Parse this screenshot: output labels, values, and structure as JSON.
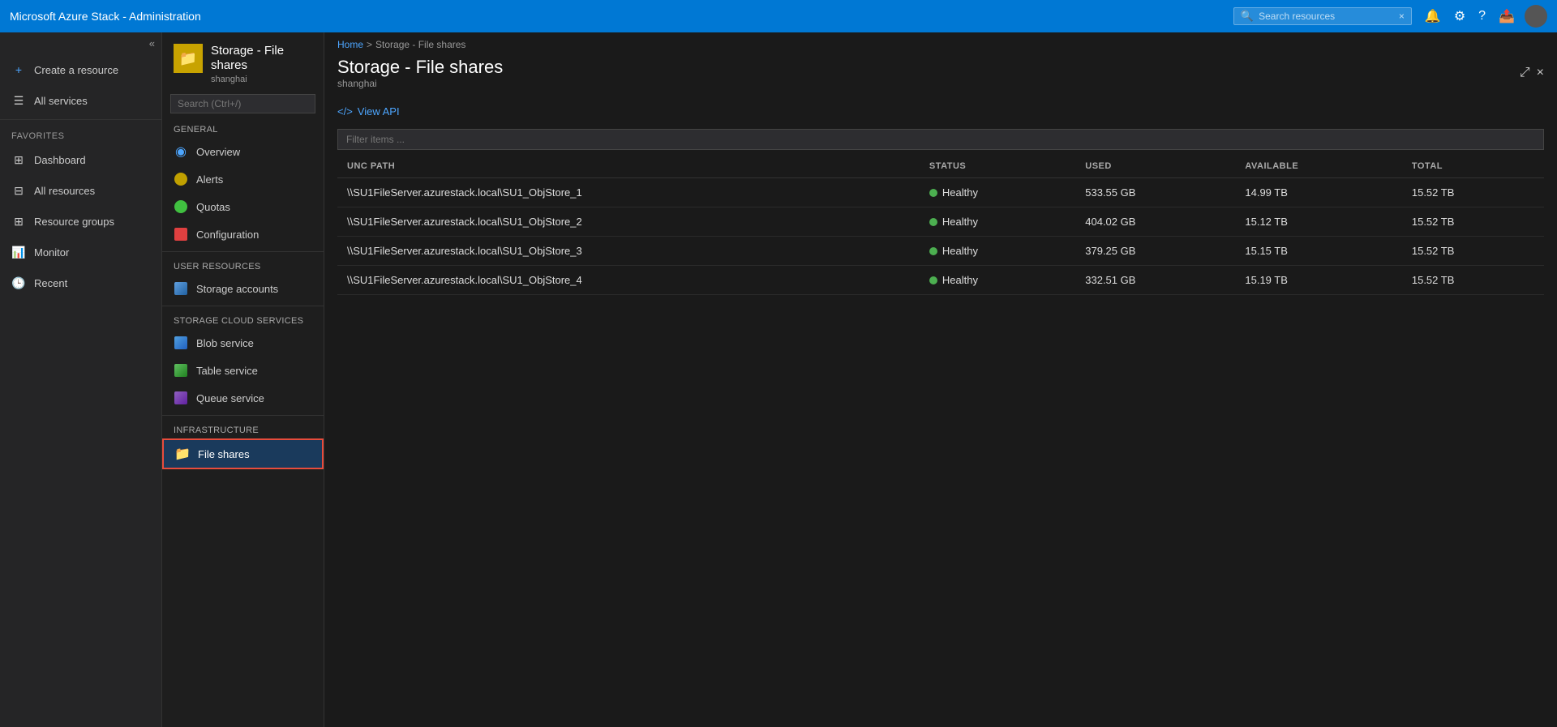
{
  "app": {
    "title": "Microsoft Azure Stack - Administration",
    "search_placeholder": "Search resources",
    "close_search": "×"
  },
  "topbar": {
    "avatar_initials": ""
  },
  "sidebar": {
    "collapse_icon": "«",
    "create_label": "Create a resource",
    "all_services_label": "All services",
    "favorites_section": "FAVORITES",
    "items": [
      {
        "label": "Dashboard",
        "icon": "⊞"
      },
      {
        "label": "All resources",
        "icon": "⊟"
      },
      {
        "label": "Resource groups",
        "icon": "⊞"
      },
      {
        "label": "Monitor",
        "icon": "📊"
      },
      {
        "label": "Recent",
        "icon": "🕒"
      }
    ]
  },
  "resource_panel": {
    "title": "Storage - File shares",
    "subtitle": "shanghai",
    "search_placeholder": "Search (Ctrl+/)",
    "general_section": "GENERAL",
    "user_resources_section": "USER RESOURCES",
    "storage_cloud_section": "STORAGE CLOUD SERVICES",
    "infrastructure_section": "INFRASTRUCTURE",
    "general_items": [
      {
        "label": "Overview",
        "icon": "overview"
      },
      {
        "label": "Alerts",
        "icon": "alerts"
      },
      {
        "label": "Quotas",
        "icon": "quotas"
      },
      {
        "label": "Configuration",
        "icon": "config"
      }
    ],
    "user_items": [
      {
        "label": "Storage accounts",
        "icon": "storage"
      }
    ],
    "cloud_items": [
      {
        "label": "Blob service",
        "icon": "blob"
      },
      {
        "label": "Table service",
        "icon": "table"
      },
      {
        "label": "Queue service",
        "icon": "queue"
      }
    ],
    "infra_items": [
      {
        "label": "File shares",
        "icon": "folder",
        "active": true
      }
    ]
  },
  "content": {
    "breadcrumb_home": "Home",
    "breadcrumb_sep": ">",
    "breadcrumb_current": "Storage - File shares",
    "title": "Storage - File shares",
    "subtitle": "shanghai",
    "window_expand": "⤢",
    "window_close": "×",
    "toolbar": {
      "view_api_label": "View API",
      "view_api_icon": "<>"
    },
    "filter_placeholder": "Filter items ...",
    "table": {
      "columns": [
        "UNC PATH",
        "STATUS",
        "USED",
        "AVAILABLE",
        "TOTAL"
      ],
      "rows": [
        {
          "unc_path": "\\\\SU1FileServer.azurestack.local\\SU1_ObjStore_1",
          "status": "Healthy",
          "used": "533.55 GB",
          "available": "14.99 TB",
          "total": "15.52 TB"
        },
        {
          "unc_path": "\\\\SU1FileServer.azurestack.local\\SU1_ObjStore_2",
          "status": "Healthy",
          "used": "404.02 GB",
          "available": "15.12 TB",
          "total": "15.52 TB"
        },
        {
          "unc_path": "\\\\SU1FileServer.azurestack.local\\SU1_ObjStore_3",
          "status": "Healthy",
          "used": "379.25 GB",
          "available": "15.15 TB",
          "total": "15.52 TB"
        },
        {
          "unc_path": "\\\\SU1FileServer.azurestack.local\\SU1_ObjStore_4",
          "status": "Healthy",
          "used": "332.51 GB",
          "available": "15.19 TB",
          "total": "15.52 TB"
        }
      ]
    }
  }
}
